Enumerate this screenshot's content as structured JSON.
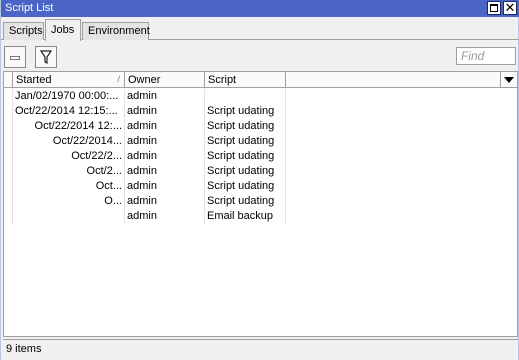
{
  "window": {
    "title": "Script List"
  },
  "tabs": [
    {
      "label": "Scripts",
      "active": false
    },
    {
      "label": "Jobs",
      "active": true
    },
    {
      "label": "Environment",
      "active": false
    }
  ],
  "toolbar": {
    "remove_icon": "minus-icon",
    "filter_icon": "funnel-icon",
    "find_placeholder": "Find"
  },
  "table": {
    "columns": [
      "Started",
      "Owner",
      "Script"
    ],
    "rows": [
      {
        "started": "Jan/02/1970 00:00:...",
        "owner": "admin",
        "script": ""
      },
      {
        "started": "Oct/22/2014 12:15:...",
        "owner": "admin",
        "script": "Script udating"
      },
      {
        "started": "Oct/22/2014 12:...",
        "owner": "admin",
        "script": "Script udating"
      },
      {
        "started": "Oct/22/2014...",
        "owner": "admin",
        "script": "Script udating"
      },
      {
        "started": "Oct/22/2...",
        "owner": "admin",
        "script": "Script udating"
      },
      {
        "started": "Oct/2...",
        "owner": "admin",
        "script": "Script udating"
      },
      {
        "started": "Oct...",
        "owner": "admin",
        "script": "Script udating"
      },
      {
        "started": "O...",
        "owner": "admin",
        "script": "Script udating"
      },
      {
        "started": "",
        "owner": "admin",
        "script": "Email backup"
      }
    ]
  },
  "status": {
    "count_text": "9 items"
  },
  "colors": {
    "titlebar": "#4b64c6",
    "background": "#f0f0f0"
  }
}
